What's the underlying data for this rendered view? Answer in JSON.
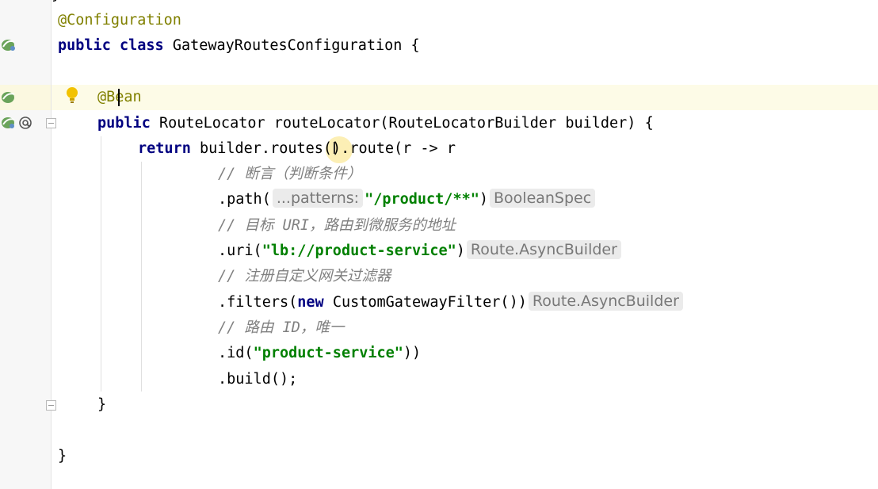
{
  "editor": {
    "lines": {
      "annotation_configuration": "@Configuration",
      "class_kw_public": "public",
      "class_kw_class": "class",
      "class_name": "GatewayRoutesConfiguration",
      "class_open_brace": "{",
      "bean_at": "@B",
      "bean_rest": "ean",
      "method_kw_public": "public",
      "method_signature": "RouteLocator routeLocator(RouteLocatorBuilder builder)",
      "method_open_brace": "{",
      "return_kw": "return",
      "return_expr": "builder.routes().route(r -> r",
      "comment_predicate": "// 断言（判断条件）",
      "path_call_open": ".path(",
      "path_param_hint": "...patterns:",
      "path_string": "\"/product/**\"",
      "path_call_close": ")",
      "path_type_hint": "BooleanSpec",
      "comment_target_uri": "// 目标 URI，路由到微服务的地址",
      "uri_call_open": ".uri(",
      "uri_string": "\"lb://product-service\"",
      "uri_call_close": ")",
      "uri_type_hint": "Route.AsyncBuilder",
      "comment_filter": "// 注册自定义网关过滤器",
      "filters_call_open": ".filters(",
      "filters_new_kw": "new",
      "filters_call_rest": "CustomGatewayFilter())",
      "filters_type_hint": "Route.AsyncBuilder",
      "comment_route_id": "// 路由 ID，唯一",
      "id_call_open": ".id(",
      "id_string": "\"product-service\"",
      "id_call_close": "))",
      "build_call": ".build();",
      "method_close_brace": "}",
      "class_close_brace": "}"
    },
    "colors": {
      "keyword": "#000080",
      "annotation": "#808000",
      "comment": "#808080",
      "string": "#008000",
      "current_line": "#fdfbe7"
    },
    "gutter_icons": [
      "spring-bean-icon",
      "spring-bean-icon",
      "spring-bean-icon",
      "implementation-at-icon"
    ]
  }
}
